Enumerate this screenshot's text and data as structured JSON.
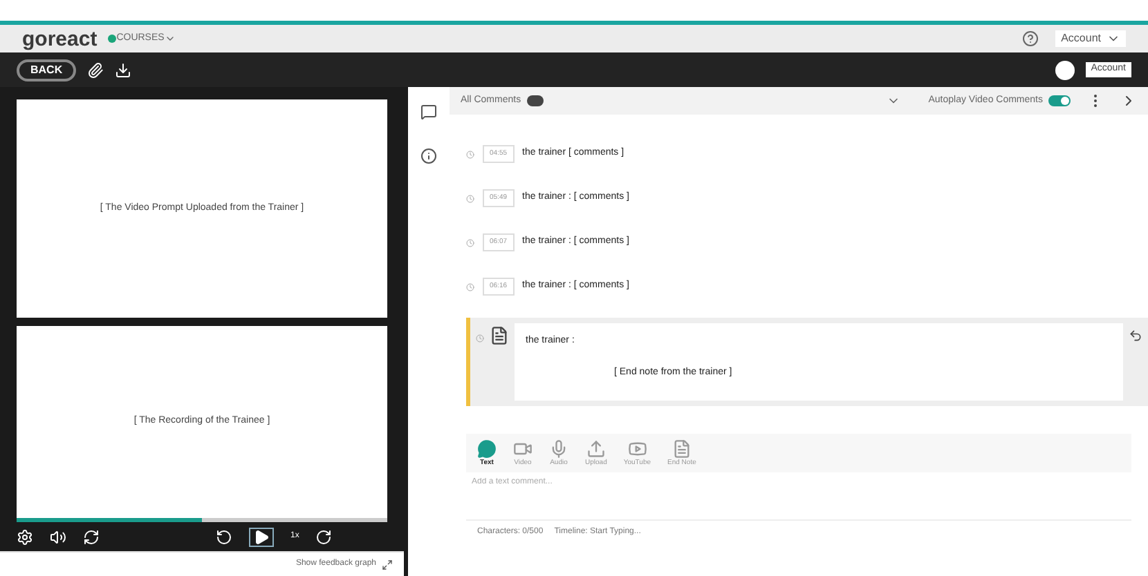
{
  "header": {
    "logo": "goreact",
    "course_menu": "COURSES",
    "account_menu": "Account"
  },
  "toolbar": {
    "back": "BACK",
    "account": "Account"
  },
  "video": {
    "prompt": "[ The Video Prompt Uploaded from the Trainer ]",
    "recording": "[ The Recording of the Trainee ]",
    "progress": {
      "level": 0.5
    },
    "speed": "1x",
    "feedback_graph": "Show feedback graph"
  },
  "comments": {
    "title": "All Comments",
    "autoplay": {
      "label": "Autoplay Video Comments",
      "on": true
    },
    "items": [
      {
        "time": "04:55",
        "author": "the trainer",
        "text": "[ comments ]"
      },
      {
        "time": "05:49",
        "author": "the trainer :",
        "text": "[ comments ]"
      },
      {
        "time": "06:07",
        "author": "the trainer :",
        "text": "[ comments ]"
      },
      {
        "time": "06:16",
        "author": "the trainer :",
        "text": "[ comments ]"
      }
    ],
    "end_note": {
      "author": "the trainer :",
      "text": "[ End note from the trainer ]"
    }
  },
  "composer": {
    "tabs": [
      {
        "kind": "text",
        "label": "Text",
        "selected": true
      },
      {
        "kind": "video",
        "label": "Video",
        "selected": false
      },
      {
        "kind": "audio",
        "label": "Audio",
        "selected": false
      },
      {
        "kind": "upload",
        "label": "Upload",
        "selected": false
      },
      {
        "kind": "youtube",
        "label": "YouTube",
        "selected": false
      },
      {
        "kind": "endnote",
        "label": "End Note",
        "selected": false
      }
    ],
    "placeholder": "Add a text comment...",
    "characters": "Characters: 0/500",
    "timeline": "Timeline: Start Typing..."
  }
}
